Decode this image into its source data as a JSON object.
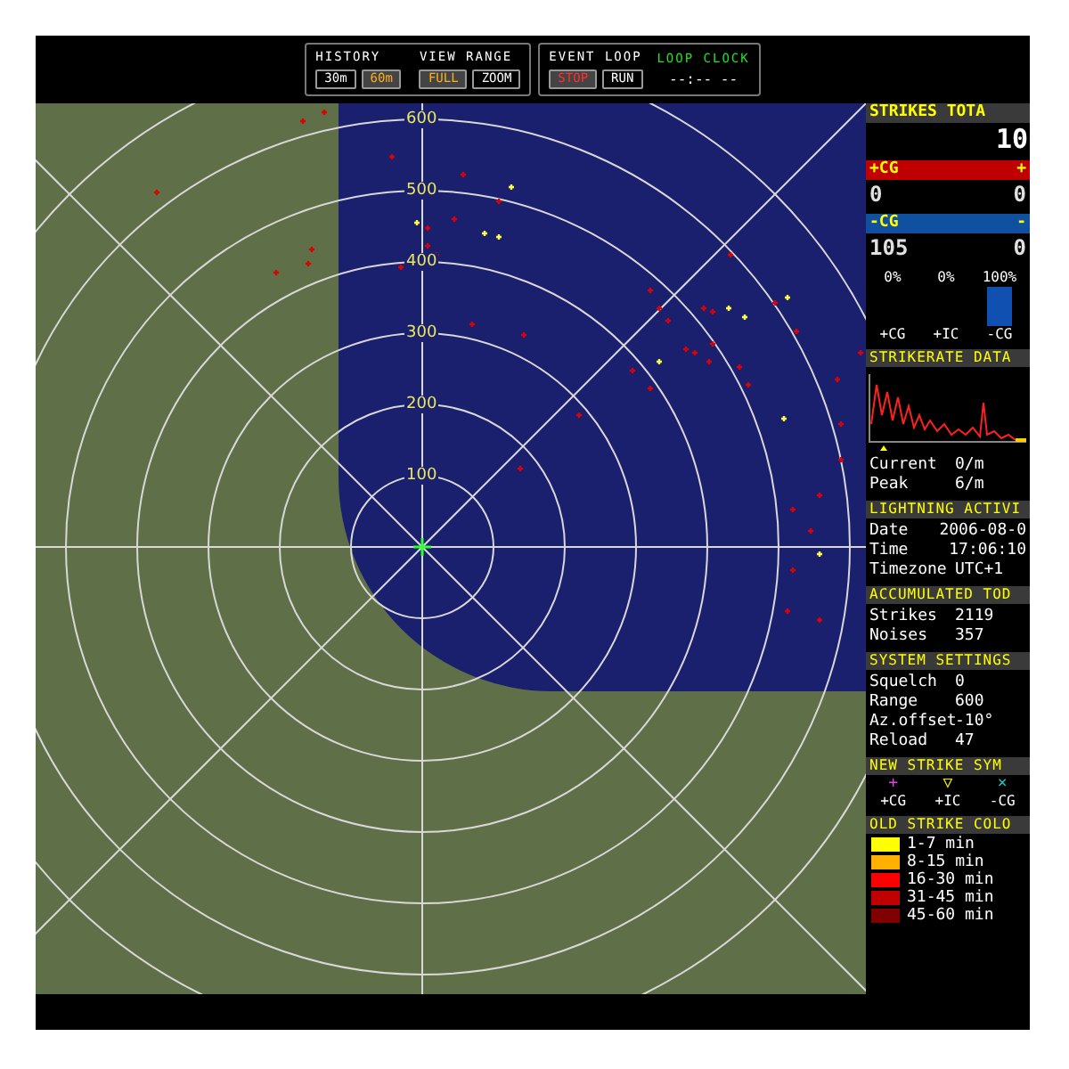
{
  "toolbar": {
    "groups": [
      {
        "title": "HISTORY",
        "buttons": [
          {
            "label": "30m",
            "selected": false
          },
          {
            "label": "60m",
            "selected": true
          }
        ]
      },
      {
        "title": "VIEW RANGE",
        "buttons": [
          {
            "label": "FULL",
            "selected": true
          },
          {
            "label": "ZOOM",
            "selected": false
          }
        ]
      },
      {
        "title": "EVENT LOOP",
        "buttons": [
          {
            "label": "STOP",
            "selected": true
          },
          {
            "label": "RUN",
            "selected": false
          }
        ]
      }
    ],
    "clock": {
      "title": "LOOP CLOCK",
      "value": "--:-- --"
    }
  },
  "map": {
    "range_labels": [
      "600",
      "500",
      "400",
      "300",
      "200",
      "100"
    ]
  },
  "strikes_total": {
    "title": "STRIKES TOTA",
    "value": "10",
    "types": [
      {
        "label": "+CG",
        "label_2": "+",
        "value": "0",
        "value_2": "0",
        "color": "#c00000"
      },
      {
        "label": "-CG",
        "label_2": "-",
        "value": "105",
        "value_2": "0",
        "color": "#1050a0"
      }
    ],
    "chart_data": {
      "type": "bar",
      "categories": [
        "+CG",
        "+IC",
        "-CG"
      ],
      "values": [
        0,
        0,
        100
      ],
      "value_labels": [
        "0%",
        "0%",
        "100%"
      ],
      "ylim": [
        0,
        100
      ]
    }
  },
  "strikerate": {
    "title": "STRIKERATE DATA",
    "rows": [
      {
        "label": "Current",
        "value": "0/m"
      },
      {
        "label": "Peak",
        "value": "6/m"
      }
    ]
  },
  "sections": [
    {
      "title": "LIGHTNING ACTIVI",
      "rows": [
        {
          "label": "Date",
          "value": "2006-08-0"
        },
        {
          "label": "Time",
          "value": "17:06:10"
        },
        {
          "label": "Timezone",
          "value": "UTC+1"
        }
      ]
    },
    {
      "title": "ACCUMULATED TOD",
      "rows": [
        {
          "label": "Strikes",
          "value": "2119"
        },
        {
          "label": "Noises",
          "value": "357"
        }
      ]
    },
    {
      "title": "SYSTEM SETTINGS",
      "rows": [
        {
          "label": "Squelch",
          "value": "0"
        },
        {
          "label": "Range",
          "value": "600"
        },
        {
          "label": "Az.offset",
          "value": "-10°"
        },
        {
          "label": "Reload",
          "value": "47"
        }
      ]
    }
  ],
  "symbols": {
    "title": "NEW STRIKE SYM",
    "items": [
      {
        "symbol": "+",
        "label": "+CG",
        "color": "#e040e0"
      },
      {
        "symbol": "▽",
        "label": "+IC",
        "color": "#f0f000"
      },
      {
        "symbol": "×",
        "label": "-CG",
        "color": "#20c0c0"
      }
    ]
  },
  "colors": {
    "title": "OLD STRIKE COLO",
    "items": [
      {
        "label": "1-7 min",
        "color": "#ffff00"
      },
      {
        "label": "8-15 min",
        "color": "#ffb000"
      },
      {
        "label": "16-30 min",
        "color": "#ff0000"
      },
      {
        "label": "31-45 min",
        "color": "#c00000"
      },
      {
        "label": "45-60 min",
        "color": "#800000"
      }
    ]
  }
}
